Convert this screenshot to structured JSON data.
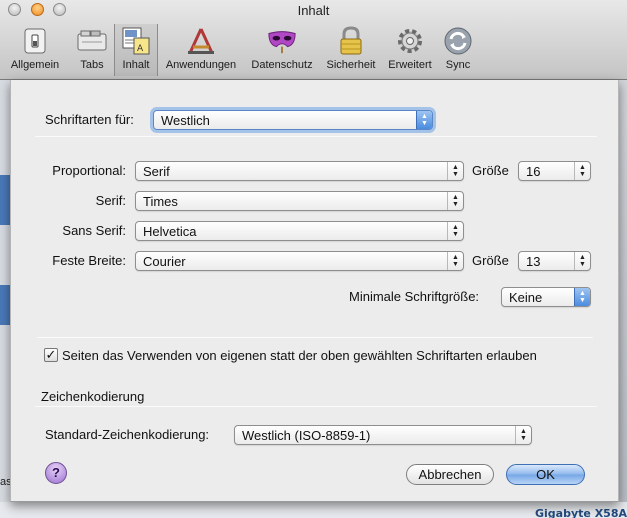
{
  "window": {
    "title": "Inhalt"
  },
  "toolbar": {
    "items": [
      {
        "label": "Allgemein",
        "icon": "switch-icon"
      },
      {
        "label": "Tabs",
        "icon": "tabs-icon"
      },
      {
        "label": "Inhalt",
        "icon": "content-icon"
      },
      {
        "label": "Anwendungen",
        "icon": "applications-icon"
      },
      {
        "label": "Datenschutz",
        "icon": "mask-icon"
      },
      {
        "label": "Sicherheit",
        "icon": "lock-icon"
      },
      {
        "label": "Erweitert",
        "icon": "gear-icon"
      },
      {
        "label": "Sync",
        "icon": "sync-icon"
      }
    ]
  },
  "fonts": {
    "for_label": "Schriftarten für:",
    "for_value": "Westlich",
    "proportional_label": "Proportional:",
    "proportional_value": "Serif",
    "size_label": "Größe",
    "proportional_size": "16",
    "serif_label": "Serif:",
    "serif_value": "Times",
    "sans_label": "Sans Serif:",
    "sans_value": "Helvetica",
    "mono_label": "Feste Breite:",
    "mono_value": "Courier",
    "mono_size": "13",
    "min_label": "Minimale Schriftgröße:",
    "min_value": "Keine",
    "allow_pages_label": "Seiten das Verwenden von eigenen statt der oben gewählten Schriftarten erlauben",
    "allow_pages_checked": true
  },
  "encoding": {
    "heading": "Zeichenkodierung",
    "default_label": "Standard-Zeichenkodierung:",
    "default_value": "Westlich (ISO-8859-1)"
  },
  "buttons": {
    "help": "?",
    "cancel": "Abbrechen",
    "ok": "OK"
  },
  "background": {
    "bottom_right_text": "Gigabyte X58A",
    "left_text": "as"
  },
  "colors": {
    "accent": "#4a8be0",
    "help": "#9b6fd1"
  }
}
